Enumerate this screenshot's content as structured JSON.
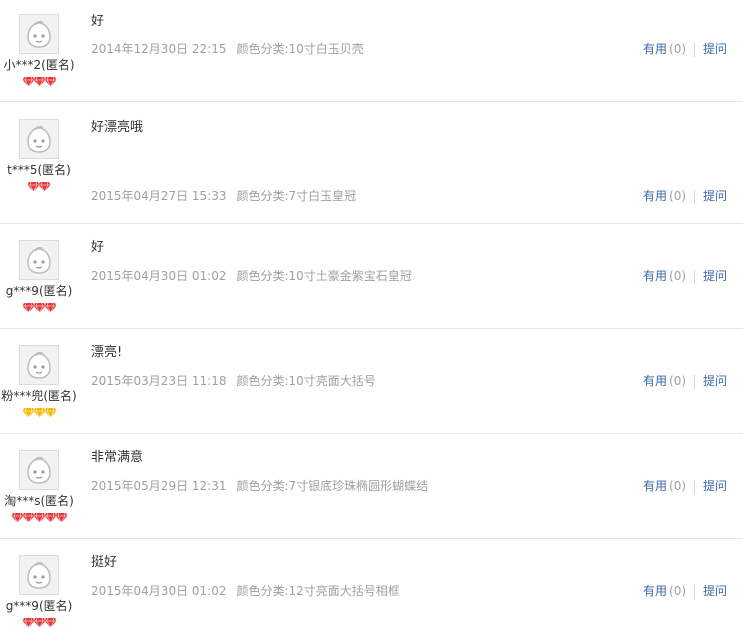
{
  "labels": {
    "useful": "有用",
    "ask": "提问"
  },
  "reviews": [
    {
      "username": "小***2(匿名)",
      "content": "好",
      "date": "2014年12月30日 22:15",
      "sku": "颜色分类:10寸白玉贝壳",
      "useful_count": "(0)",
      "rank": "red",
      "rank_count": 3
    },
    {
      "username": "t***5(匿名)",
      "content": "好漂亮哦",
      "date": "2015年04月27日 15:33",
      "sku": "颜色分类:7寸白玉皇冠",
      "useful_count": "(0)",
      "rank": "red",
      "rank_count": 2
    },
    {
      "username": "g***9(匿名)",
      "content": "好",
      "date": "2015年04月30日 01:02",
      "sku": "颜色分类:10寸土豪金紫宝石皇冠",
      "useful_count": "(0)",
      "rank": "red",
      "rank_count": 3
    },
    {
      "username": "粉***兜(匿名)",
      "content": "漂亮!",
      "date": "2015年03月23日 11:18",
      "sku": "颜色分类:10寸亮面大括号",
      "useful_count": "(0)",
      "rank": "yellow",
      "rank_count": 3
    },
    {
      "username": "淘***s(匿名)",
      "content": "非常满意",
      "date": "2015年05月29日 12:31",
      "sku": "颜色分类:7寸银底珍珠椭圆形蝴蝶结",
      "useful_count": "(0)",
      "rank": "red",
      "rank_count": 5
    },
    {
      "username": "g***9(匿名)",
      "content": "挺好",
      "date": "2015年04月30日 01:02",
      "sku": "颜色分类:12寸亮面大括号相框",
      "useful_count": "(0)",
      "rank": "red",
      "rank_count": 3
    }
  ],
  "colors": {
    "link": "#3a68a8",
    "meta": "#a0a0a0",
    "gem_red": "#e4393c",
    "gem_yellow": "#f5b800"
  },
  "icons": {
    "avatar": "default-avatar-icon",
    "rank_red": "red-diamond-icon",
    "rank_yellow": "yellow-diamond-icon"
  }
}
